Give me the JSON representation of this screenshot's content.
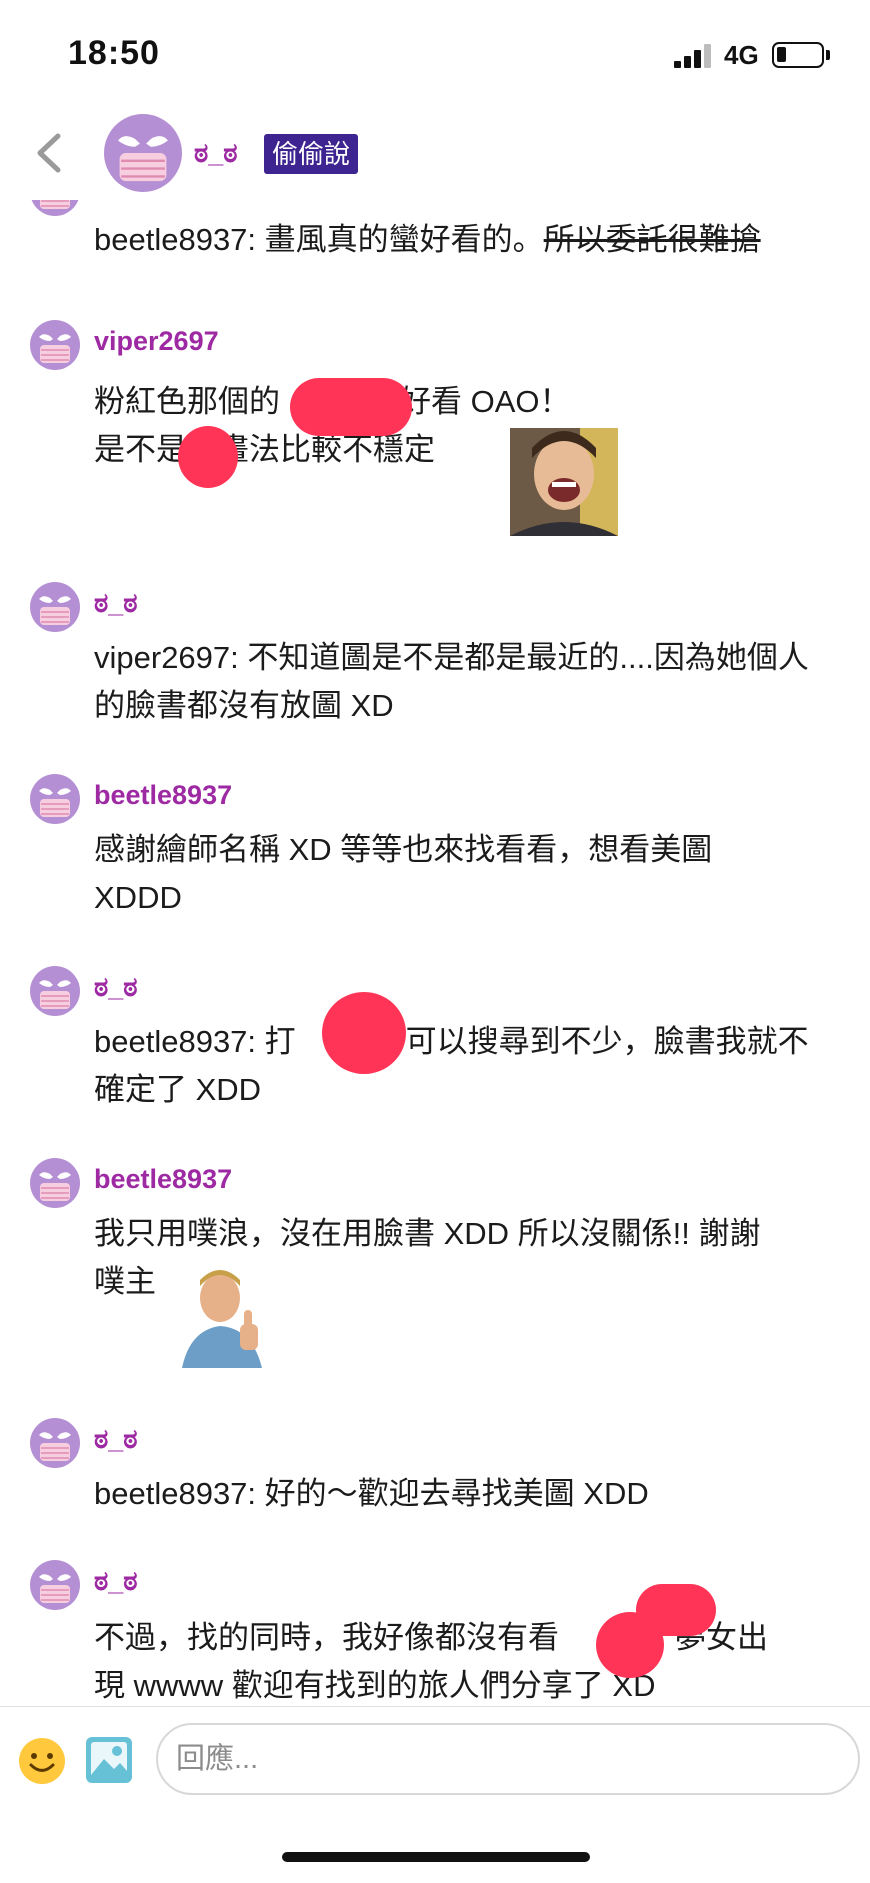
{
  "status_bar": {
    "time": "18:50",
    "network": "4G",
    "battery_level": 0.22
  },
  "header": {
    "name": "ಠ_ಠ",
    "badge": "偷偷說"
  },
  "messages": [
    {
      "name": "ಠ_ಠ",
      "text_plain": "beetle8937: 畫風真的蠻好看的。",
      "text_strike": "所以委託很難搶"
    },
    {
      "name": "viper2697",
      "line1": "粉紅色那個的",
      "line1_end": "好看 OAO！",
      "line2_start": "是不是",
      "line2_end": "的畫法比較不穩定"
    },
    {
      "name": "ಠ_ಠ",
      "text": "viper2697: 不知道圖是不是都是最近的....因為她個人的臉書都沒有放圖 XD"
    },
    {
      "name": "beetle8937",
      "text": "感謝繪師名稱 XD 等等也來找看看，想看美圖 XDDD"
    },
    {
      "name": "ಠ_ಠ",
      "line1_start": "beetle8937: 打",
      "line1_end": "可以搜尋到不少，臉書我就不",
      "line2": "確定了 XDD"
    },
    {
      "name": "beetle8937",
      "line1": "我只用噗浪，沒在用臉書 XDD 所以沒關係!! 謝謝",
      "line2": "噗主"
    },
    {
      "name": "ಠ_ಠ",
      "text": "beetle8937: 好的～歡迎去尋找美圖 XDD"
    },
    {
      "name": "ಠ_ಠ",
      "line1_start": "不過，找的同時，我好像都沒有看",
      "line1_end": "夢女出",
      "line2": "現 wwww 歡迎有找到的旅人們分享了 XD"
    }
  ],
  "input": {
    "placeholder": "回應..."
  },
  "icons": {
    "back": "chevron-left-icon",
    "emoji": "smiley-icon",
    "image": "image-icon",
    "avatar": "masked-face-icon"
  },
  "colors": {
    "name": "#9e2aa3",
    "badge": "#3d2490",
    "redaction": "#ff3456",
    "avatar_bg": "#b58fd3"
  }
}
